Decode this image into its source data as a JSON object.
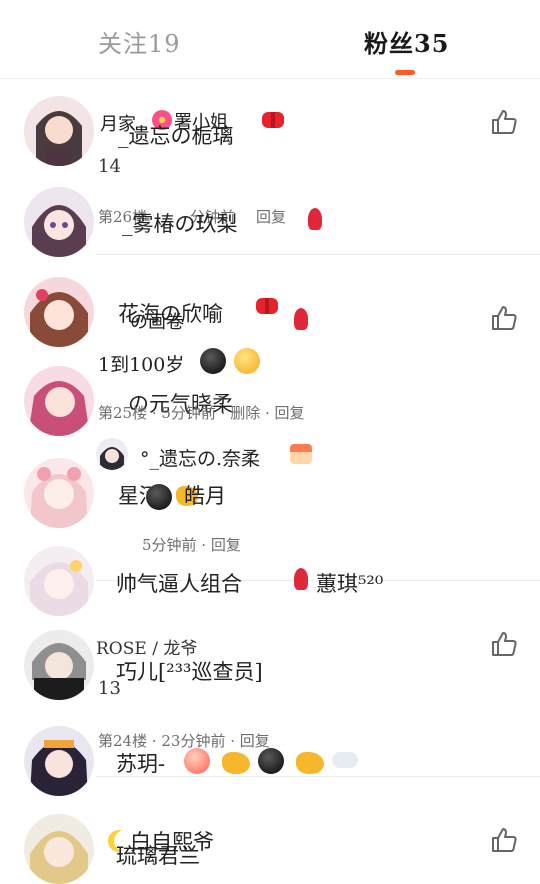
{
  "tabs": {
    "following": "关注19",
    "fans": "粉丝35"
  },
  "colors": {
    "accent": "#ff5a1f",
    "meta_text": "#6e6e6e",
    "divider": "#ededed"
  },
  "texts": {
    "t1": "月家",
    "t2": "_遗忘の栀璃",
    "t3": "署小姐",
    "t4": "14",
    "t5": "第26楼",
    "t6": "分钟前",
    "t7": "回复",
    "t8": "_雾椿の玖梨",
    "t9": "花海の欣喻",
    "t10": "の画卷",
    "t11": "1到100岁",
    "t12": "の元气晓柔",
    "t13": "第25楼 · 5分钟前 · 删除 · 回复",
    "t14": "°_遗忘の.奈柔",
    "t15": "星河",
    "t16": "皓月",
    "t17": "5分钟前 · 回复",
    "t18": "帅气逼人组合",
    "t19": "蕙琪⁵²⁰",
    "t20": "ROSE / 龙爷",
    "t21": "巧儿[²³³巡查员]",
    "t22": "13",
    "t23": "第24楼 · 23分钟前 · 回复",
    "t24": "苏玥-",
    "t25": "白自熙爷",
    "t26": "琉璃君兰"
  },
  "icons": [
    "thumbs-up-icon",
    "bow-emoji",
    "tulip-emoji",
    "dark-moon-face-emoji",
    "moon-face-emoji",
    "pointing-hand-emoji",
    "peach-emoji",
    "dash-emoji",
    "cake-emoji",
    "crescent-moon-emoji",
    "flower-emoji"
  ]
}
